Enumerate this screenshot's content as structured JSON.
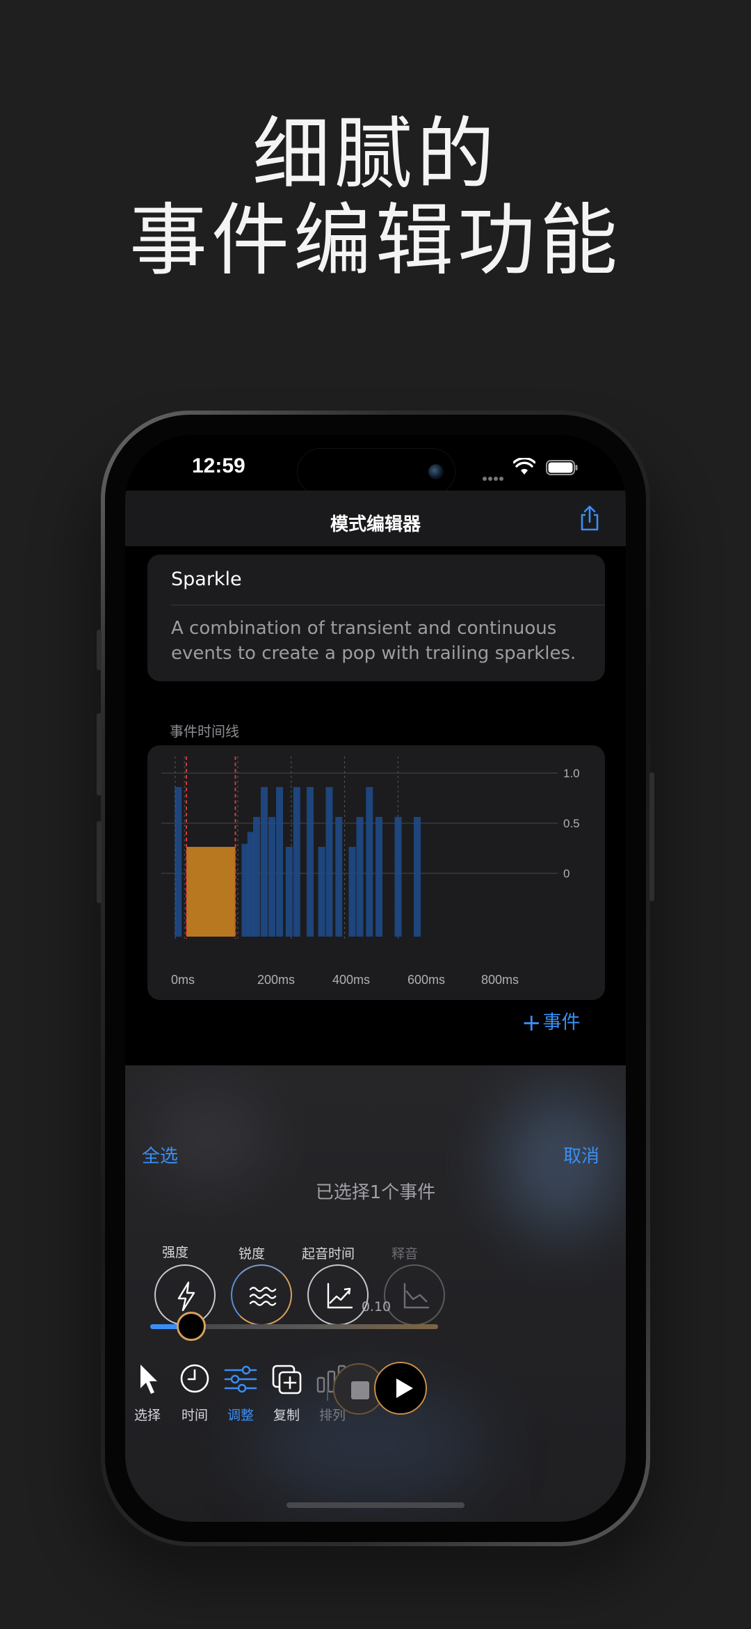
{
  "headline": {
    "line1": "细腻的",
    "line2": "事件编辑功能"
  },
  "status_bar": {
    "time": "12:59"
  },
  "nav": {
    "title": "模式编辑器",
    "share_icon": "share-icon"
  },
  "pattern": {
    "name": "Sparkle",
    "description": "A combination of transient and continuous events to create a pop with trailing sparkles."
  },
  "timeline": {
    "section_label": "事件时间线",
    "add_event_label": "事件",
    "colors": {
      "transient": "#1f4a86",
      "continuous": "#b8781f",
      "marker": "#d23b3b"
    }
  },
  "chart_data": {
    "type": "bar",
    "title": "",
    "xlabel": "",
    "ylabel": "",
    "x_ticks": [
      "0ms",
      "200ms",
      "400ms",
      "600ms",
      "800ms"
    ],
    "y_ticks": [
      "0",
      "0.5",
      "1.0"
    ],
    "xlim": [
      -50,
      950
    ],
    "ylim": [
      0,
      1.0
    ],
    "series": [
      {
        "kind": "transient",
        "x": [
          -25,
          150,
          165,
          180,
          200,
          220,
          240,
          265,
          285,
          320,
          350,
          370,
          395,
          430,
          450,
          475,
          500,
          550,
          600
        ],
        "values": [
          1.0,
          0.62,
          0.7,
          0.8,
          1.0,
          0.8,
          1.0,
          0.6,
          1.0,
          1.0,
          0.6,
          1.0,
          0.8,
          0.6,
          0.8,
          1.0,
          0.8,
          0.8,
          0.8
        ]
      },
      {
        "kind": "continuous",
        "start": 0,
        "end": 150,
        "value": 0.6
      }
    ],
    "selection": {
      "start": 0,
      "end": 150
    }
  },
  "edit_panel": {
    "select_all": "全选",
    "cancel": "取消",
    "selected_count": "已选择1个事件",
    "params": [
      {
        "label": "强度",
        "icon": "lightning-icon"
      },
      {
        "label": "锐度",
        "icon": "waves-icon"
      },
      {
        "label": "起音时间",
        "icon": "attack-curve-icon"
      },
      {
        "label": "释音",
        "icon": "release-curve-icon"
      }
    ],
    "value": "0.10",
    "slider_fraction": 0.1
  },
  "toolbar": {
    "select": "选择",
    "time": "时间",
    "adjust": "调整",
    "copy": "复制",
    "arrange": "排列"
  }
}
